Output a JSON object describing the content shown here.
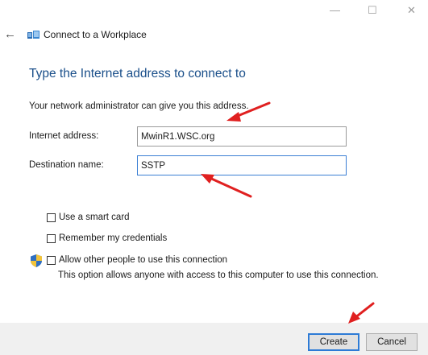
{
  "window": {
    "minimize_glyph": "—",
    "maximize_glyph": "☐",
    "close_glyph": "✕"
  },
  "header": {
    "back_glyph": "←",
    "title": "Connect to a Workplace"
  },
  "main": {
    "heading": "Type the Internet address to connect to",
    "info": "Your network administrator can give you this address.",
    "internet_address": {
      "label": "Internet address:",
      "value": "MwinR1.WSC.org"
    },
    "destination_name": {
      "label": "Destination name:",
      "value": "SSTP"
    },
    "options": {
      "smart_card": "Use a smart card",
      "remember_credentials": "Remember my credentials",
      "allow_others": "Allow other people to use this connection"
    },
    "note": "This option allows anyone with access to this computer to use this connection."
  },
  "footer": {
    "create_label": "Create",
    "cancel_label": "Cancel"
  },
  "colors": {
    "heading": "#1a4f8a",
    "accent": "#2d7bd6",
    "annotation_arrow": "#e02020"
  },
  "icons": [
    "back-arrow-icon",
    "network-workplace-icon",
    "uac-shield-icon",
    "annotation-arrow"
  ]
}
